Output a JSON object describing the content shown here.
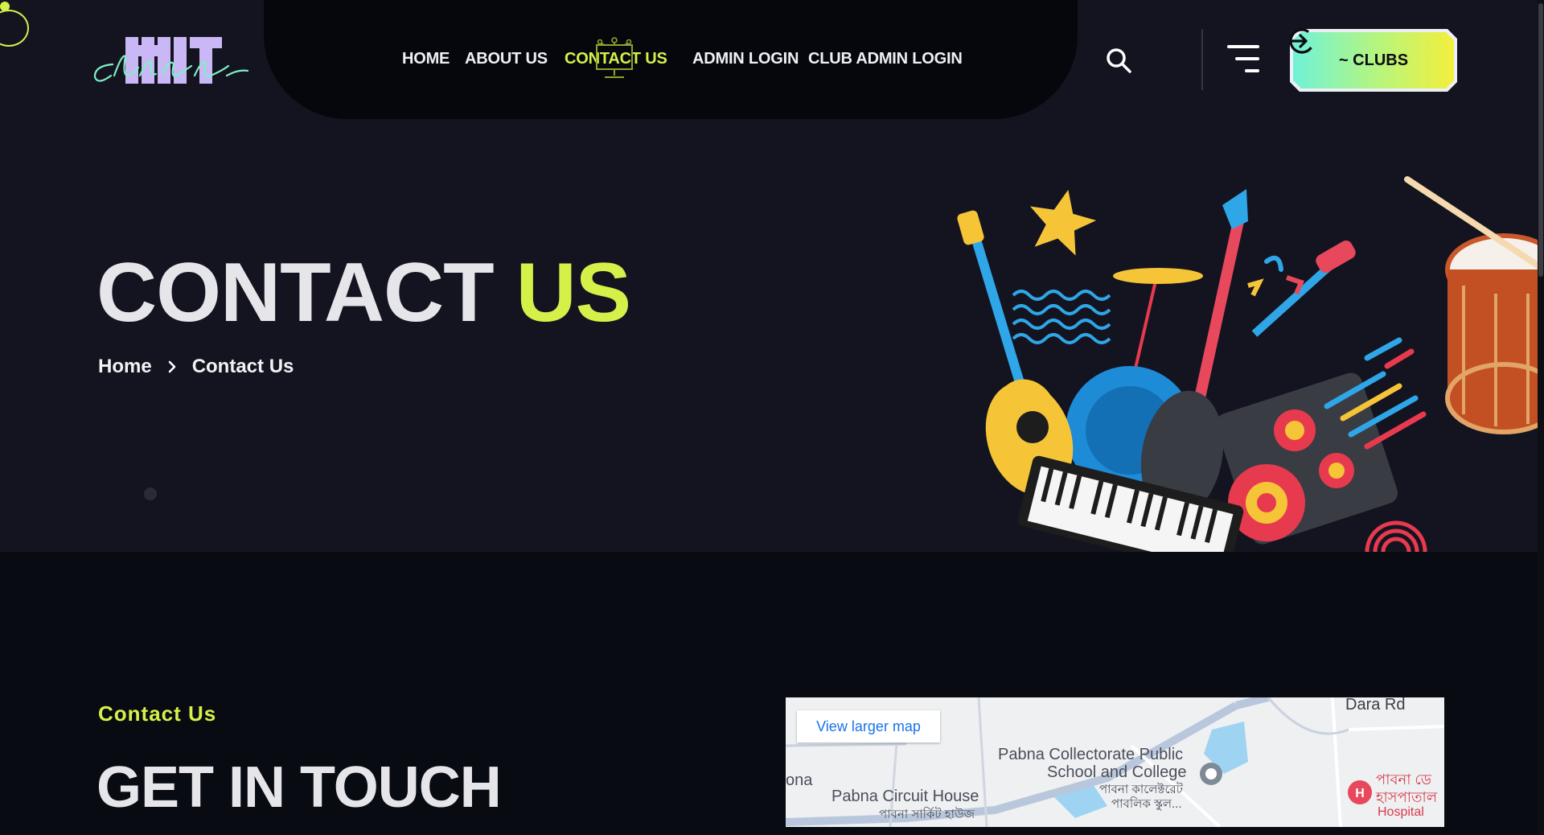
{
  "nav": {
    "items": [
      {
        "label": "HOME",
        "active": false
      },
      {
        "label": "ABOUT US",
        "active": false
      },
      {
        "label": "CONTACT US",
        "active": true
      },
      {
        "label": "ADMIN LOGIN",
        "active": false
      },
      {
        "label": "CLUB ADMIN LOGIN",
        "active": false
      }
    ],
    "clubs_button": "~ CLUBS"
  },
  "hero": {
    "title_part1": "CONTACT",
    "title_part2": "US",
    "breadcrumb": {
      "home": "Home",
      "current": "Contact Us"
    }
  },
  "contact": {
    "subtitle": "Contact Us",
    "heading": "GET IN TOUCH"
  },
  "map": {
    "view_larger": "View larger map",
    "labels": {
      "road_top": "Dara Rd",
      "school_en_1": "Pabna Collectorate Public",
      "school_en_2": "School and College",
      "school_bn_1": "পাবনা কালেক্টরেট",
      "school_bn_2": "পাবলিক স্কুল...",
      "circuit_en": "Pabna Circuit House",
      "circuit_bn": "পাবনা সার্কিট হাউজ",
      "left_cut": "ona",
      "hospital_bn_1": "পাবনা ডে",
      "hospital_bn_2": "হাসপাতাল",
      "hospital_en": "Hospital"
    }
  },
  "colors": {
    "accent": "#d6f04a",
    "hero_bg": "#141420",
    "page_bg": "#090b12",
    "map_link": "#1a73e8"
  }
}
